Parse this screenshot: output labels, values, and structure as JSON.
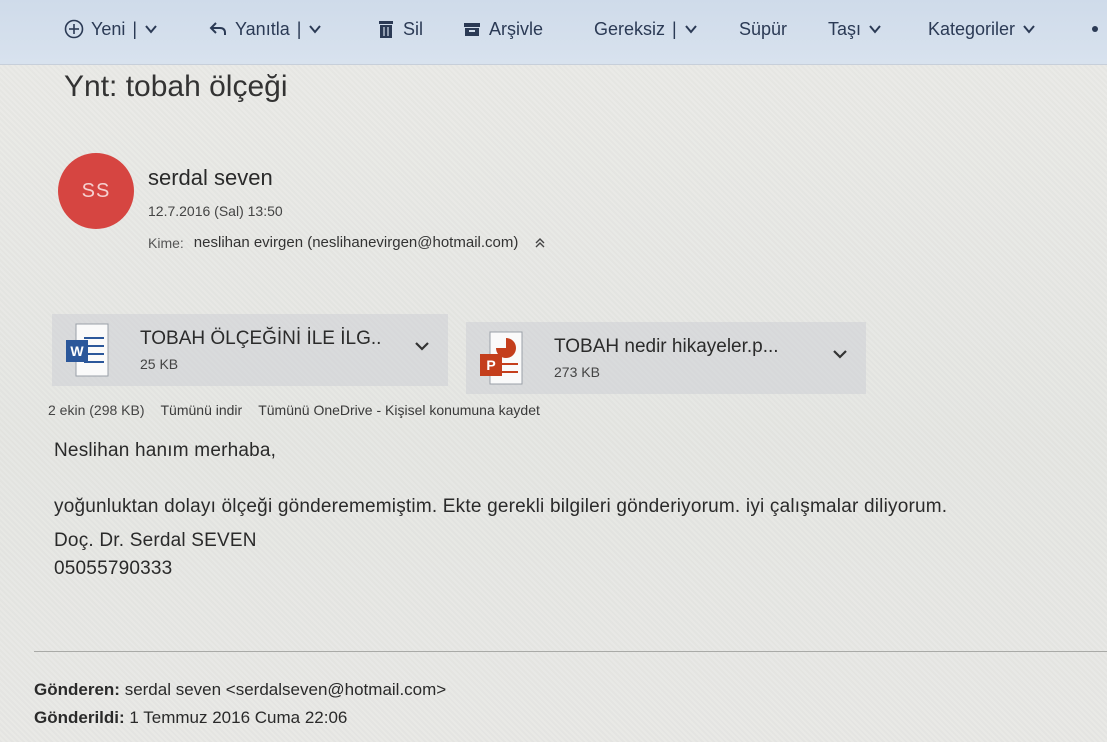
{
  "toolbar": {
    "new_label": "Yeni",
    "reply_label": "Yanıtla",
    "delete_label": "Sil",
    "archive_label": "Arşivle",
    "junk_label": "Gereksiz",
    "sweep_label": "Süpür",
    "move_label": "Taşı",
    "categories_label": "Kategoriler",
    "separator": "|"
  },
  "message": {
    "subject": "Ynt: tobah ölçeği",
    "sender": {
      "initials": "SS",
      "name": "serdal seven",
      "date": "12.7.2016 (Sal) 13:50",
      "avatar_color": "#d64541"
    },
    "to_label": "Kime:",
    "to_value": "neslihan evirgen (neslihanevirgen@hotmail.com)"
  },
  "attachments": {
    "items": [
      {
        "name": "TOBAH ÖLÇEĞİNİ İLE İLG..",
        "size": "25 KB",
        "icon": "word-doc-icon"
      },
      {
        "name": "TOBAH nedir hikayeler.p...",
        "size": "273 KB",
        "icon": "powerpoint-icon"
      }
    ],
    "summary": "2 ekin (298 KB)",
    "download_all": "Tümünü indir",
    "save_onedrive": "Tümünü OneDrive - Kişisel konumuna kaydet"
  },
  "body": {
    "greeting": "Neslihan hanım merhaba,",
    "line1": "yoğunluktan dolayı ölçeği gönderememiştim. Ekte gerekli bilgileri gönderiyorum. iyi çalışmalar diliyorum.",
    "signature_name": "Doç. Dr. Serdal SEVEN",
    "signature_phone": "05055790333"
  },
  "quoted": {
    "from_label": "Gönderen:",
    "from_value": "serdal seven <serdalseven@hotmail.com>",
    "sent_label": "Gönderildi:",
    "sent_value": "1 Temmuz 2016 Cuma 22:06"
  },
  "colors": {
    "toolbar_bg": "#d3deeb",
    "word_blue": "#2b579a",
    "powerpoint_red": "#c43e1c"
  }
}
